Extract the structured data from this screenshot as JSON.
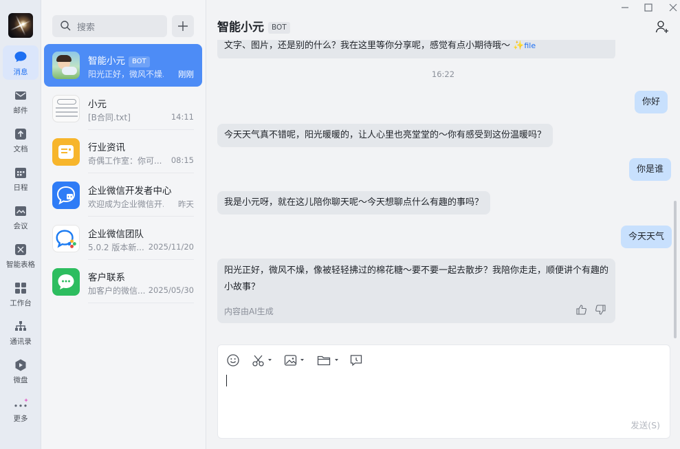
{
  "nav": {
    "items": [
      {
        "label": "消息"
      },
      {
        "label": "邮件"
      },
      {
        "label": "文档"
      },
      {
        "label": "日程"
      },
      {
        "label": "会议"
      },
      {
        "label": "智能表格"
      },
      {
        "label": "工作台"
      },
      {
        "label": "通讯录"
      },
      {
        "label": "微盘"
      },
      {
        "label": "更多"
      }
    ],
    "accent": "#1d6ff2"
  },
  "search": {
    "placeholder": "搜索"
  },
  "conversations": [
    {
      "name": "智能小元",
      "badge": "BOT",
      "preview": "阳光正好，微风不燥...",
      "time": "刚刚",
      "active": true
    },
    {
      "name": "小元",
      "preview": "[B合同.txt]",
      "time": "14:11"
    },
    {
      "name": "行业资讯",
      "preview": "奇偶工作室：你可...",
      "time": "08:15"
    },
    {
      "name": "企业微信开发者中心",
      "preview": "欢迎成为企业微信开...",
      "time": "昨天"
    },
    {
      "name": "企业微信团队",
      "preview": "5.0.2 版本新...",
      "time": "2025/11/20"
    },
    {
      "name": "客户联系",
      "preview": "加客户的微信...",
      "time": "2025/05/30"
    }
  ],
  "chat": {
    "title": "智能小元",
    "title_badge": "BOT",
    "top_cut_message": "文字、图片，还是别的什么？我在这里等你分享呢，感觉有点小期待哦～",
    "top_cut_file": "file",
    "timestamp": "16:22",
    "messages": [
      {
        "from": "me",
        "text": "你好"
      },
      {
        "from": "bot",
        "text": "今天天气真不错呢，阳光暖暖的，让人心里也亮堂堂的～你有感受到这份温暖吗？"
      },
      {
        "from": "me",
        "text": "你是谁"
      },
      {
        "from": "bot",
        "text": "我是小元呀，就在这儿陪你聊天呢～今天想聊点什么有趣的事吗？"
      },
      {
        "from": "me",
        "text": "今天天气"
      },
      {
        "from": "bot",
        "text": "阳光正好，微风不燥，像被轻轻拂过的棉花糖～要不要一起去散步？我陪你走走，顺便讲个有趣的小故事？",
        "footer": "内容由AI生成"
      }
    ]
  },
  "composer": {
    "send_label": "发送(S)"
  }
}
